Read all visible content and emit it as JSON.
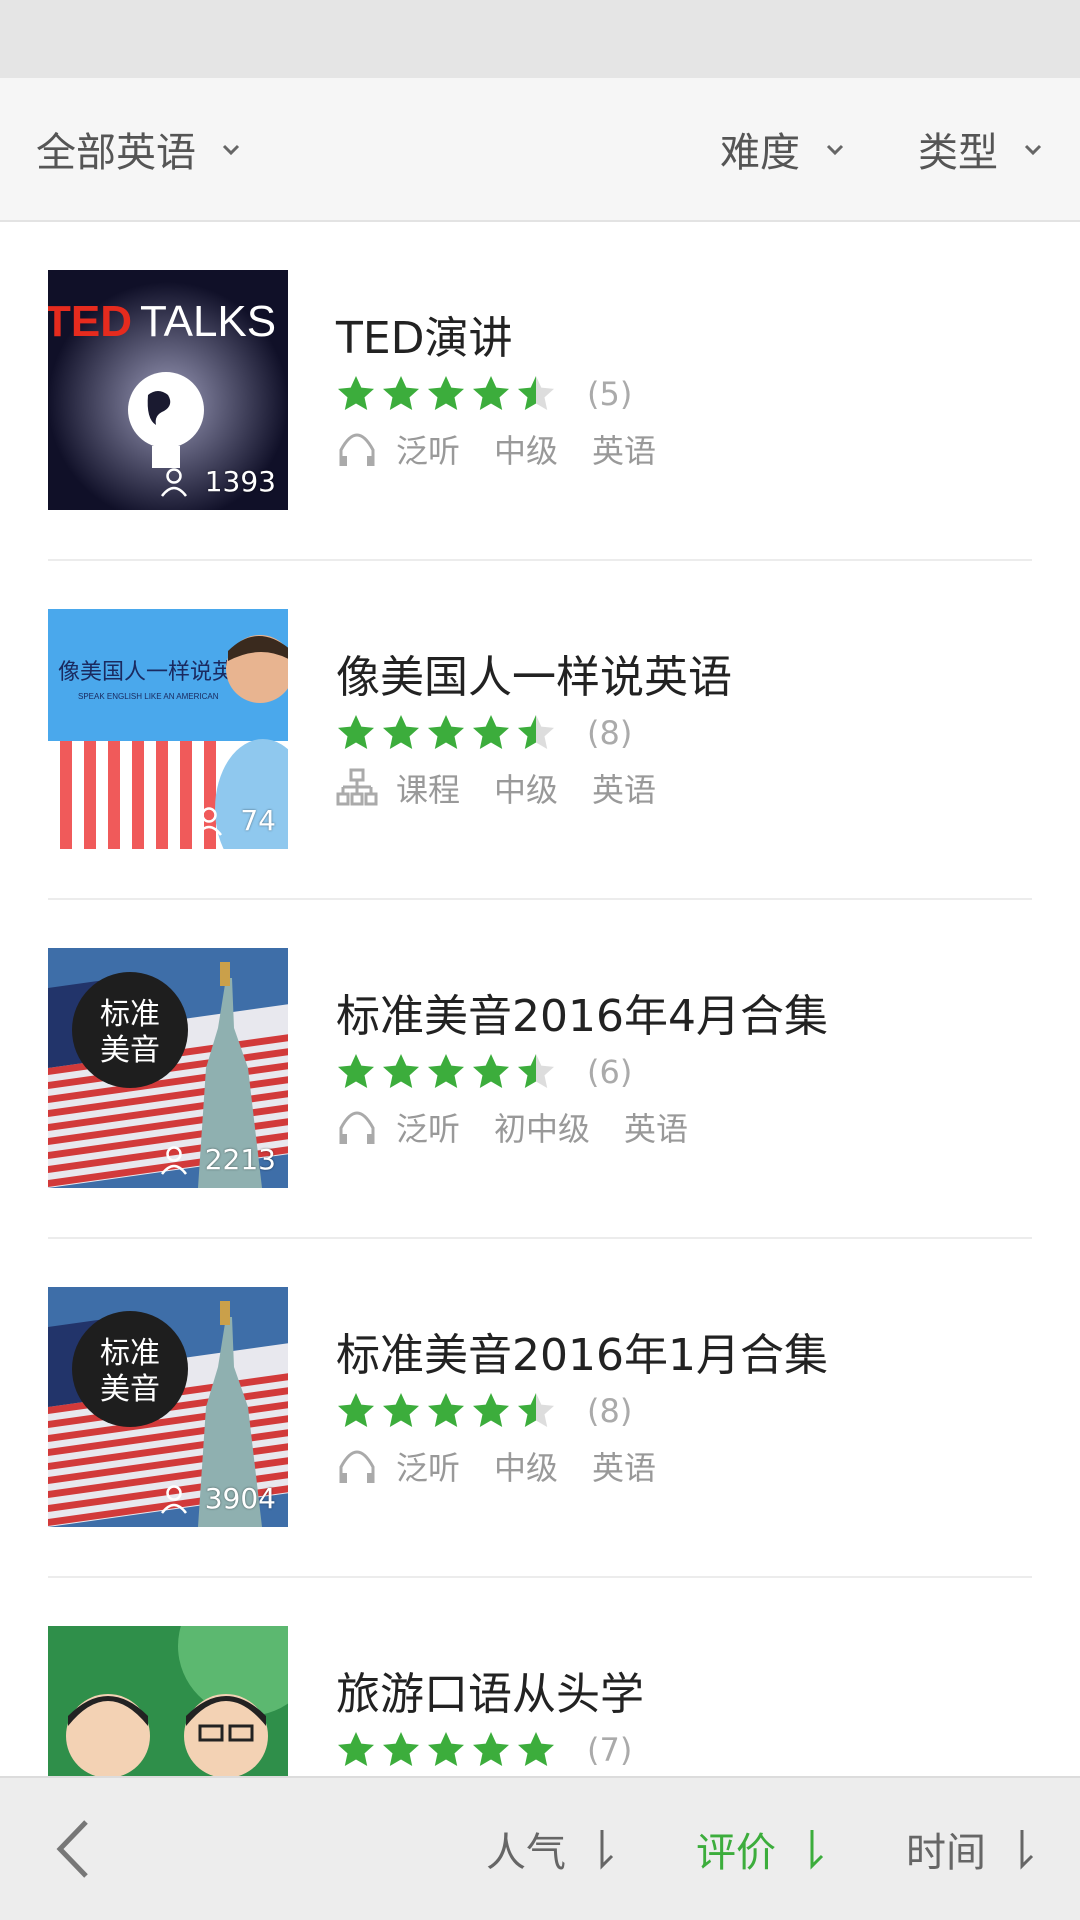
{
  "filters": {
    "language": "全部英语",
    "difficulty": "难度",
    "type": "类型"
  },
  "courses": [
    {
      "title": "TED演讲",
      "rating": 4.5,
      "rating_count": "(5)",
      "learners": "1393",
      "type_icon": "headphones-icon",
      "tags": [
        "泛听",
        "中级",
        "英语"
      ],
      "thumb": "ted"
    },
    {
      "title": "像美国人一样说英语",
      "rating": 4.5,
      "rating_count": "(8)",
      "learners": "74",
      "type_icon": "course-tree-icon",
      "tags": [
        "课程",
        "中级",
        "英语"
      ],
      "thumb": "american",
      "thumb_text": "像美国人一样说英语",
      "thumb_subtext": "SPEAK ENGLISH LIKE AN AMERICAN"
    },
    {
      "title": "标准美音2016年4月合集",
      "rating": 4.5,
      "rating_count": "(6)",
      "learners": "2213",
      "type_icon": "headphones-icon",
      "tags": [
        "泛听",
        "初中级",
        "英语"
      ],
      "thumb": "liberty",
      "thumb_text_1": "标准",
      "thumb_text_2": "美音"
    },
    {
      "title": "标准美音2016年1月合集",
      "rating": 4.5,
      "rating_count": "(8)",
      "learners": "3904",
      "type_icon": "headphones-icon",
      "tags": [
        "泛听",
        "中级",
        "英语"
      ],
      "thumb": "liberty",
      "thumb_text_1": "标准",
      "thumb_text_2": "美音"
    },
    {
      "title": "旅游口语从头学",
      "rating": 5,
      "rating_count": "(7)",
      "learners": "",
      "type_icon": "",
      "tags": [],
      "thumb": "cartoon"
    }
  ],
  "sort": {
    "popularity": "人气",
    "rating": "评价",
    "time": "时间",
    "active": "rating"
  },
  "colors": {
    "accent": "#3cad3c",
    "star_empty": "#dddddd"
  }
}
